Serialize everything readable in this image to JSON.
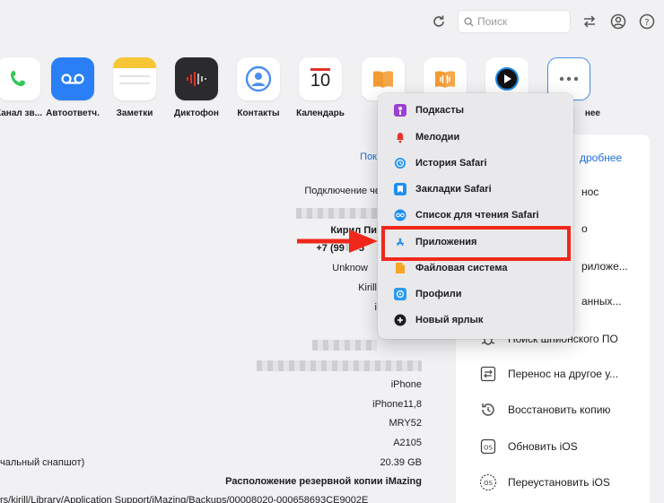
{
  "toolbar": {
    "search_placeholder": "Поиск"
  },
  "apps": [
    {
      "label": "Канал зв...",
      "color": "#34c759"
    },
    {
      "label": "Автоответч.",
      "color": "#2b7ff6"
    },
    {
      "label": "Заметки",
      "color": "#f7c634"
    },
    {
      "label": "Диктофон",
      "color": "#e0332a"
    },
    {
      "label": "Контакты",
      "color": "#4a8ef2"
    },
    {
      "label": "Календарь",
      "date": "10"
    },
    {
      "label": "",
      "color": "#f39b33"
    },
    {
      "label": "",
      "color": "#f39b33"
    },
    {
      "label": "",
      "color": "#1a8ae6"
    },
    {
      "label": "нее"
    }
  ],
  "info": {
    "link": "Пок",
    "connection_label": "Подключение че",
    "owner": "Кирил Пи",
    "phone": "+7 (99",
    "phone_tail": "5",
    "unknown": "Unknow",
    "kirill": "Kirill",
    "i": "i",
    "device": "iPhone",
    "model_id": "iPhone11,8",
    "part": "MRY52",
    "model_num": "A2105",
    "snapshot": "чальный снапшот)",
    "size": "20.39 GB",
    "backup_label": "Расположение резервной копии iMazing",
    "backup_path": "rs/kirill/Library/Application Support/iMazing/Backups/00008020-000658693CE9002E"
  },
  "panel": {
    "more_link": "дробнее",
    "actions": [
      {
        "label": "нос"
      },
      {
        "label": "о"
      },
      {
        "label": "риложе..."
      },
      {
        "label": "анных..."
      },
      {
        "label": "Поиск шпионского ПО"
      },
      {
        "label": "Перенос на другое у..."
      },
      {
        "label": "Восстановить копию"
      },
      {
        "label": "Обновить iOS"
      },
      {
        "label": "Переустановить iOS"
      }
    ]
  },
  "menu": {
    "items": [
      {
        "label": "Подкасты",
        "color": "#9b3fd6"
      },
      {
        "label": "Мелодии",
        "color": "#e8332a"
      },
      {
        "label": "История Safari",
        "color": "#1f8ef1"
      },
      {
        "label": "Закладки Safari",
        "color": "#1f8ef1"
      },
      {
        "label": "Список для чтения Safari",
        "color": "#1f8ef1"
      },
      {
        "label": "Приложения",
        "color": "#1f8ef1"
      },
      {
        "label": "Файловая система",
        "color": "#f5a623"
      },
      {
        "label": "Профили",
        "color": "#2a9bf0"
      },
      {
        "label": "Новый ярлык",
        "color": "#1d1d1f"
      }
    ],
    "highlighted_index": 5
  },
  "colors": {
    "accent": "#1f6fe0",
    "highlight": "#f0281b"
  }
}
